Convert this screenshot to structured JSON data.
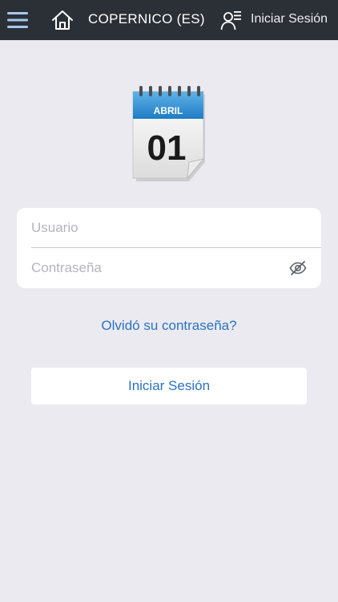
{
  "header": {
    "title": "COPERNICO (ES)",
    "login_label": "Iniciar Sesión",
    "icons": [
      "menu-icon",
      "home-icon",
      "user-list-icon"
    ]
  },
  "logo": {
    "month": "ABRIL",
    "day": "01"
  },
  "form": {
    "username_placeholder": "Usuario",
    "username_value": "",
    "password_placeholder": "Contraseña",
    "password_value": "",
    "password_toggle_icon": "eye-slash-icon"
  },
  "forgot_password_label": "Olvidó su contraseña?",
  "submit_label": "Iniciar Sesión",
  "colors": {
    "header_bg": "#2b3036",
    "page_bg": "#ebeaf0",
    "accent": "#2a72c4",
    "menu_icon": "#a7c8ef"
  }
}
